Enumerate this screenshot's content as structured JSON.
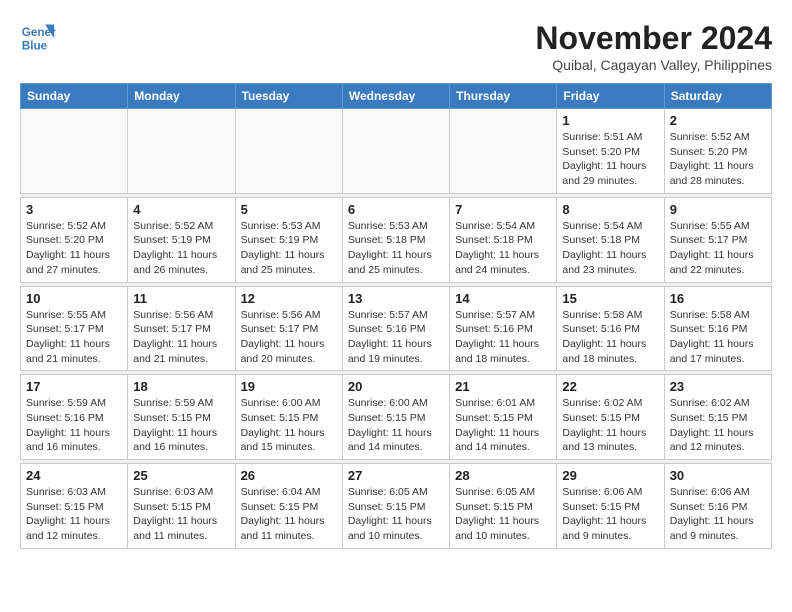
{
  "logo": {
    "line1": "General",
    "line2": "Blue"
  },
  "title": "November 2024",
  "location": "Quibal, Cagayan Valley, Philippines",
  "days_of_week": [
    "Sunday",
    "Monday",
    "Tuesday",
    "Wednesday",
    "Thursday",
    "Friday",
    "Saturday"
  ],
  "weeks": [
    [
      {
        "day": "",
        "info": ""
      },
      {
        "day": "",
        "info": ""
      },
      {
        "day": "",
        "info": ""
      },
      {
        "day": "",
        "info": ""
      },
      {
        "day": "",
        "info": ""
      },
      {
        "day": "1",
        "info": "Sunrise: 5:51 AM\nSunset: 5:20 PM\nDaylight: 11 hours and 29 minutes."
      },
      {
        "day": "2",
        "info": "Sunrise: 5:52 AM\nSunset: 5:20 PM\nDaylight: 11 hours and 28 minutes."
      }
    ],
    [
      {
        "day": "3",
        "info": "Sunrise: 5:52 AM\nSunset: 5:20 PM\nDaylight: 11 hours and 27 minutes."
      },
      {
        "day": "4",
        "info": "Sunrise: 5:52 AM\nSunset: 5:19 PM\nDaylight: 11 hours and 26 minutes."
      },
      {
        "day": "5",
        "info": "Sunrise: 5:53 AM\nSunset: 5:19 PM\nDaylight: 11 hours and 25 minutes."
      },
      {
        "day": "6",
        "info": "Sunrise: 5:53 AM\nSunset: 5:18 PM\nDaylight: 11 hours and 25 minutes."
      },
      {
        "day": "7",
        "info": "Sunrise: 5:54 AM\nSunset: 5:18 PM\nDaylight: 11 hours and 24 minutes."
      },
      {
        "day": "8",
        "info": "Sunrise: 5:54 AM\nSunset: 5:18 PM\nDaylight: 11 hours and 23 minutes."
      },
      {
        "day": "9",
        "info": "Sunrise: 5:55 AM\nSunset: 5:17 PM\nDaylight: 11 hours and 22 minutes."
      }
    ],
    [
      {
        "day": "10",
        "info": "Sunrise: 5:55 AM\nSunset: 5:17 PM\nDaylight: 11 hours and 21 minutes."
      },
      {
        "day": "11",
        "info": "Sunrise: 5:56 AM\nSunset: 5:17 PM\nDaylight: 11 hours and 21 minutes."
      },
      {
        "day": "12",
        "info": "Sunrise: 5:56 AM\nSunset: 5:17 PM\nDaylight: 11 hours and 20 minutes."
      },
      {
        "day": "13",
        "info": "Sunrise: 5:57 AM\nSunset: 5:16 PM\nDaylight: 11 hours and 19 minutes."
      },
      {
        "day": "14",
        "info": "Sunrise: 5:57 AM\nSunset: 5:16 PM\nDaylight: 11 hours and 18 minutes."
      },
      {
        "day": "15",
        "info": "Sunrise: 5:58 AM\nSunset: 5:16 PM\nDaylight: 11 hours and 18 minutes."
      },
      {
        "day": "16",
        "info": "Sunrise: 5:58 AM\nSunset: 5:16 PM\nDaylight: 11 hours and 17 minutes."
      }
    ],
    [
      {
        "day": "17",
        "info": "Sunrise: 5:59 AM\nSunset: 5:16 PM\nDaylight: 11 hours and 16 minutes."
      },
      {
        "day": "18",
        "info": "Sunrise: 5:59 AM\nSunset: 5:15 PM\nDaylight: 11 hours and 16 minutes."
      },
      {
        "day": "19",
        "info": "Sunrise: 6:00 AM\nSunset: 5:15 PM\nDaylight: 11 hours and 15 minutes."
      },
      {
        "day": "20",
        "info": "Sunrise: 6:00 AM\nSunset: 5:15 PM\nDaylight: 11 hours and 14 minutes."
      },
      {
        "day": "21",
        "info": "Sunrise: 6:01 AM\nSunset: 5:15 PM\nDaylight: 11 hours and 14 minutes."
      },
      {
        "day": "22",
        "info": "Sunrise: 6:02 AM\nSunset: 5:15 PM\nDaylight: 11 hours and 13 minutes."
      },
      {
        "day": "23",
        "info": "Sunrise: 6:02 AM\nSunset: 5:15 PM\nDaylight: 11 hours and 12 minutes."
      }
    ],
    [
      {
        "day": "24",
        "info": "Sunrise: 6:03 AM\nSunset: 5:15 PM\nDaylight: 11 hours and 12 minutes."
      },
      {
        "day": "25",
        "info": "Sunrise: 6:03 AM\nSunset: 5:15 PM\nDaylight: 11 hours and 11 minutes."
      },
      {
        "day": "26",
        "info": "Sunrise: 6:04 AM\nSunset: 5:15 PM\nDaylight: 11 hours and 11 minutes."
      },
      {
        "day": "27",
        "info": "Sunrise: 6:05 AM\nSunset: 5:15 PM\nDaylight: 11 hours and 10 minutes."
      },
      {
        "day": "28",
        "info": "Sunrise: 6:05 AM\nSunset: 5:15 PM\nDaylight: 11 hours and 10 minutes."
      },
      {
        "day": "29",
        "info": "Sunrise: 6:06 AM\nSunset: 5:15 PM\nDaylight: 11 hours and 9 minutes."
      },
      {
        "day": "30",
        "info": "Sunrise: 6:06 AM\nSunset: 5:16 PM\nDaylight: 11 hours and 9 minutes."
      }
    ]
  ]
}
